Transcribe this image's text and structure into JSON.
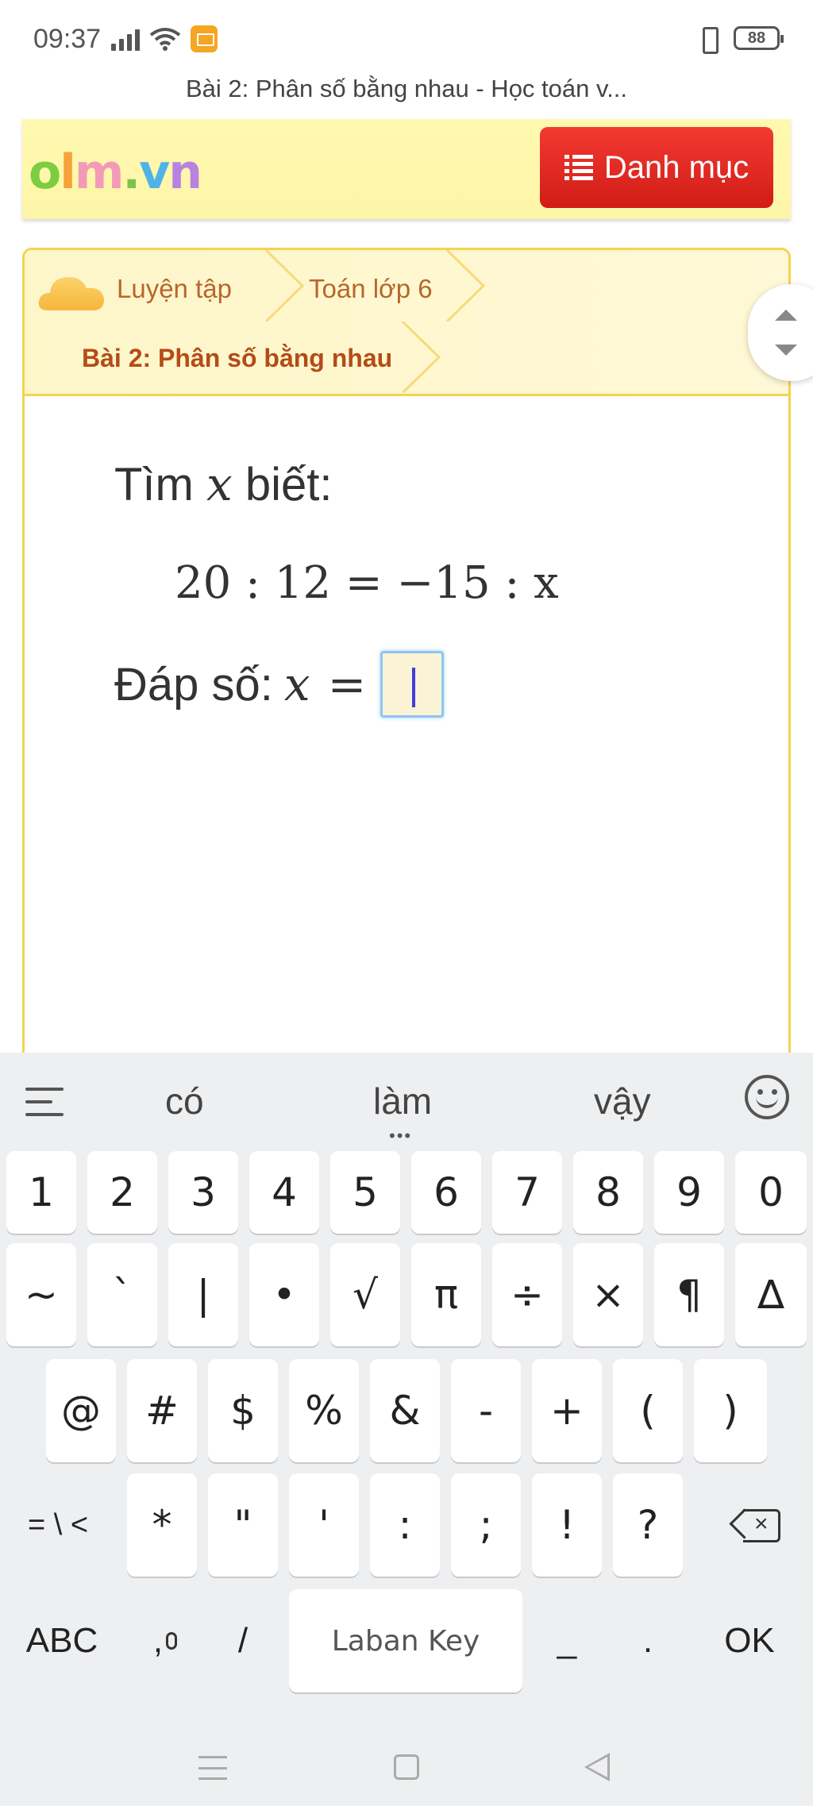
{
  "status_bar": {
    "time": "09:37",
    "battery": "88"
  },
  "browser": {
    "page_title": "Bài 2: Phân số bằng nhau - Học toán v..."
  },
  "site": {
    "logo": {
      "o": "o",
      "l": "l",
      "m": "m",
      "dot": ".",
      "v": "v",
      "n": "n"
    },
    "menu_button_label": "Danh mục"
  },
  "breadcrumb": {
    "items": [
      "Luyện tập",
      "Toán lớp 6",
      "Bài 2: Phân số bằng nhau"
    ]
  },
  "question": {
    "prompt_prefix": "Tìm",
    "prompt_var": "x",
    "prompt_suffix": "biết:",
    "equation": "20 : 12 = −15 : x",
    "answer_prefix": "Đáp số:",
    "answer_var": "x",
    "answer_equals": "=",
    "answer_value": ""
  },
  "keyboard": {
    "suggestions": [
      "có",
      "làm",
      "vậy"
    ],
    "row1": [
      "1",
      "2",
      "3",
      "4",
      "5",
      "6",
      "7",
      "8",
      "9",
      "0"
    ],
    "row2": [
      "~",
      "`",
      "|",
      "•",
      "√",
      "π",
      "÷",
      "×",
      "¶",
      "∆"
    ],
    "row3": [
      "@",
      "#",
      "$",
      "%",
      "&",
      "-",
      "+",
      "(",
      ")"
    ],
    "row4_mode": "= \\ <",
    "row4": [
      "*",
      "\"",
      "'",
      ":",
      ";",
      "!",
      "?"
    ],
    "row5": {
      "abc": "ABC",
      "comma": ",",
      "slash": "/",
      "space": "Laban Key",
      "underscore": "_",
      "period": ".",
      "ok": "OK"
    }
  },
  "icons": {
    "menu_list": "list-icon",
    "cloud": "cloud-icon",
    "emoji": "emoji-icon",
    "backspace": "backspace-icon",
    "mic": "mic-icon"
  }
}
